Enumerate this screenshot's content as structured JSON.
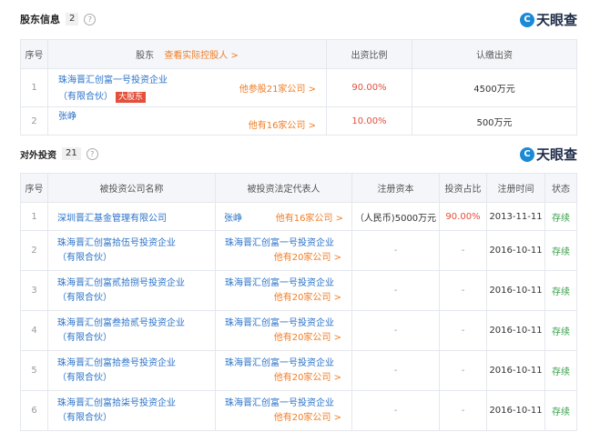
{
  "brand": {
    "logo_text": "天眼查",
    "logo_symbol": "C"
  },
  "shareholders": {
    "title": "股东信息",
    "count": "2",
    "help_icon": "?",
    "columns": {
      "seq": "序号",
      "holder": "股东",
      "holder_link": "查看实际控股人 >",
      "ratio": "出资比例",
      "subscribed": "认缴出资"
    },
    "rows": [
      {
        "seq": "1",
        "name_line1": "珠海晋汇创富一号投资企业",
        "name_line2": "（有限合伙）",
        "badge": "大股东",
        "link": "他参股21家公司 >",
        "ratio": "90.00%",
        "amount": "4500万元"
      },
      {
        "seq": "2",
        "name_line1": "张峥",
        "name_line2": "",
        "badge": "",
        "link": "他有16家公司 >",
        "ratio": "10.00%",
        "amount": "500万元"
      }
    ]
  },
  "investments": {
    "title": "对外投资",
    "count": "21",
    "help_icon": "?",
    "columns": {
      "seq": "序号",
      "company": "被投资公司名称",
      "legal_rep": "被投资法定代表人",
      "capital": "注册资本",
      "ratio": "投资占比",
      "date": "注册时间",
      "status": "状态"
    },
    "rows": [
      {
        "seq": "1",
        "company_line1": "深圳晋汇基金管理有限公司",
        "company_line2": "",
        "rep": "张峥",
        "rep_link": "他有16家公司 >",
        "capital": "（人民币)5000万元",
        "ratio": "90.00%",
        "date": "2013-11-11",
        "status": "存续"
      },
      {
        "seq": "2",
        "company_line1": "珠海晋汇创富拾伍号投资企业",
        "company_line2": "（有限合伙）",
        "rep": "珠海晋汇创富一号投资企业",
        "rep_link": "他有20家公司 >",
        "capital": "-",
        "ratio": "-",
        "date": "2016-10-11",
        "status": "存续"
      },
      {
        "seq": "3",
        "company_line1": "珠海晋汇创富贰拾捌号投资企业",
        "company_line2": "（有限合伙）",
        "rep": "珠海晋汇创富一号投资企业",
        "rep_link": "他有20家公司 >",
        "capital": "-",
        "ratio": "-",
        "date": "2016-10-11",
        "status": "存续"
      },
      {
        "seq": "4",
        "company_line1": "珠海晋汇创富叁拾贰号投资企业",
        "company_line2": "（有限合伙）",
        "rep": "珠海晋汇创富一号投资企业",
        "rep_link": "他有20家公司 >",
        "capital": "-",
        "ratio": "-",
        "date": "2016-10-11",
        "status": "存续"
      },
      {
        "seq": "5",
        "company_line1": "珠海晋汇创富拾叁号投资企业",
        "company_line2": "（有限合伙）",
        "rep": "珠海晋汇创富一号投资企业",
        "rep_link": "他有20家公司 >",
        "capital": "-",
        "ratio": "-",
        "date": "2016-10-11",
        "status": "存续"
      },
      {
        "seq": "6",
        "company_line1": "珠海晋汇创富拾柒号投资企业",
        "company_line2": "（有限合伙）",
        "rep": "珠海晋汇创富一号投资企业",
        "rep_link": "他有20家公司 >",
        "capital": "-",
        "ratio": "-",
        "date": "2016-10-11",
        "status": "存续"
      }
    ]
  }
}
